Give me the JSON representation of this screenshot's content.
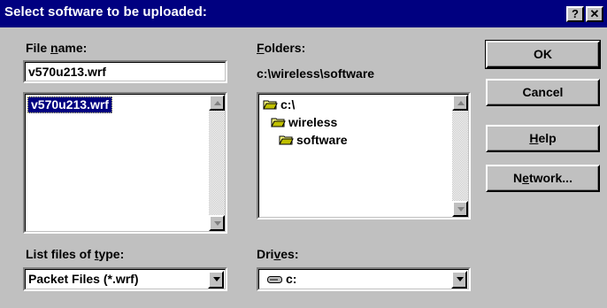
{
  "window": {
    "title": "Select software to be uploaded:",
    "help_button": "?",
    "close_button": "✕"
  },
  "file_name": {
    "label_before": "File ",
    "label_accel": "n",
    "label_after": "ame:",
    "value": "v570u213.wrf",
    "list": [
      "v570u213.wrf"
    ]
  },
  "folders": {
    "label_accel": "F",
    "label_after": "olders:",
    "current_path": "c:\\wireless\\software",
    "tree": [
      "c:\\",
      "wireless",
      "software"
    ]
  },
  "file_type": {
    "label_before": "List files of ",
    "label_accel": "t",
    "label_after": "ype:",
    "value": "Packet Files (*.wrf)"
  },
  "drives": {
    "label_before": "Dri",
    "label_accel": "v",
    "label_after": "es:",
    "value": "c:"
  },
  "buttons": {
    "ok": "OK",
    "cancel": "Cancel",
    "help_accel": "H",
    "help_after": "elp",
    "network_before": "N",
    "network_accel": "e",
    "network_after": "twork..."
  }
}
